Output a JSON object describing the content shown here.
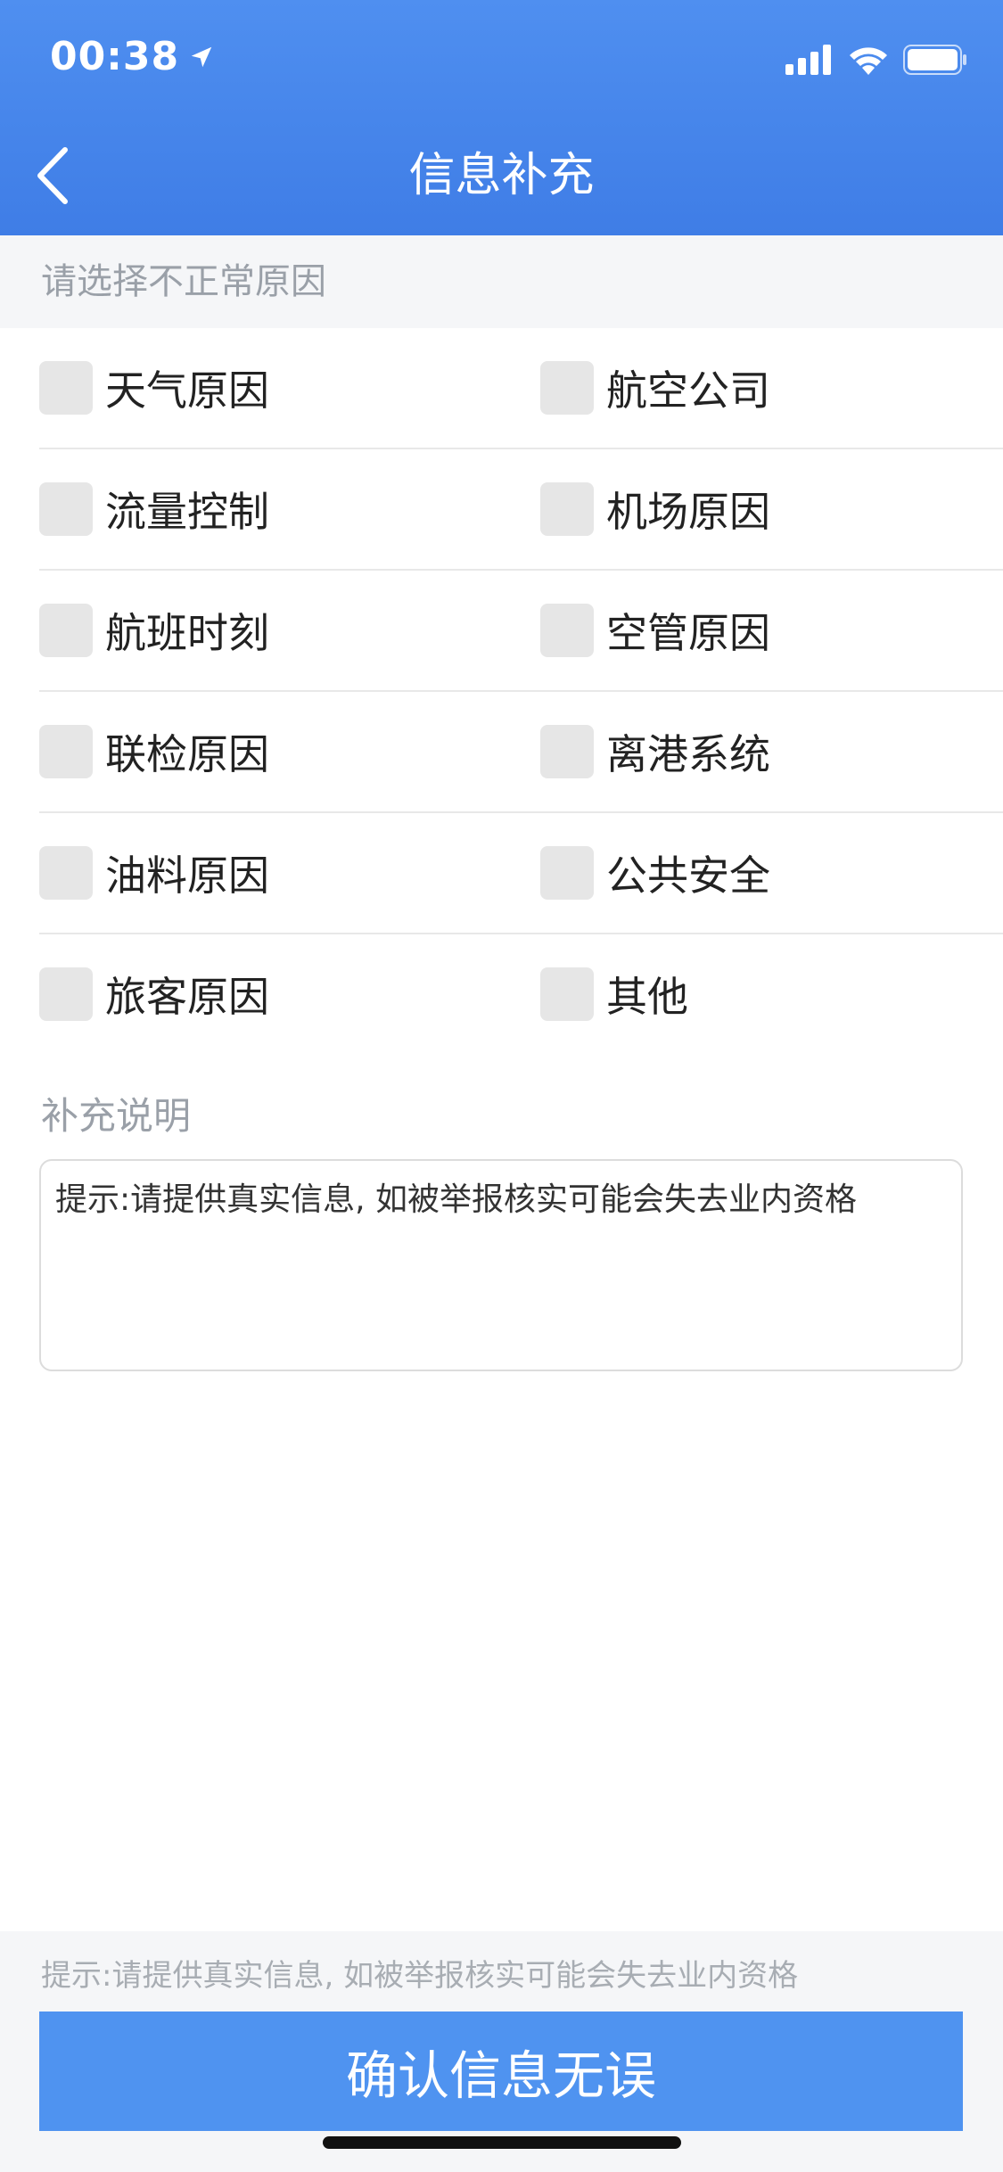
{
  "status_bar": {
    "time": "00:38",
    "icons": [
      "location-arrow-icon",
      "signal-icon",
      "wifi-icon",
      "battery-icon"
    ]
  },
  "nav": {
    "title": "信息补充",
    "back_icon": "chevron-left-icon"
  },
  "section": {
    "label": "请选择不正常原因"
  },
  "options": [
    [
      "天气原因",
      "航空公司"
    ],
    [
      "流量控制",
      "机场原因"
    ],
    [
      "航班时刻",
      "空管原因"
    ],
    [
      "联检原因",
      "离港系统"
    ],
    [
      "油料原因",
      "公共安全"
    ],
    [
      "旅客原因",
      "其他"
    ]
  ],
  "remark": {
    "label": "补充说明",
    "placeholder": "提示:请提供真实信息, 如被举报核实可能会失去业内资格"
  },
  "footer": {
    "hint": "提示:请提供真实信息, 如被举报核实可能会失去业内资格",
    "confirm_label": "确认信息无误"
  },
  "colors": {
    "header": "#4185eb",
    "button": "#4f93f0",
    "checkbox": "#e6e6e6"
  }
}
